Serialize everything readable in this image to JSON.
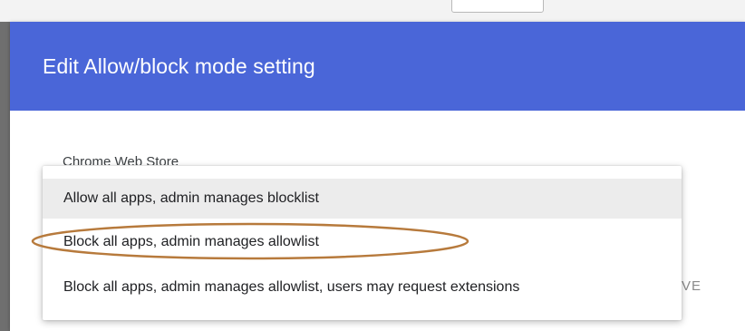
{
  "dialog": {
    "title": "Edit Allow/block mode setting",
    "field_label": "Chrome Web Store",
    "obscured_text": "VE",
    "header_color": "#4a66d8"
  },
  "dropdown": {
    "options": [
      {
        "label": "Allow all apps, admin manages blocklist",
        "hovered": true
      },
      {
        "label": "Block all apps, admin manages allowlist",
        "circled": true
      },
      {
        "label": "Block all apps, admin manages allowlist, users may request extensions"
      }
    ]
  },
  "annotation": {
    "shape": "ellipse",
    "color": "#b77a3c",
    "target_option": 1
  }
}
